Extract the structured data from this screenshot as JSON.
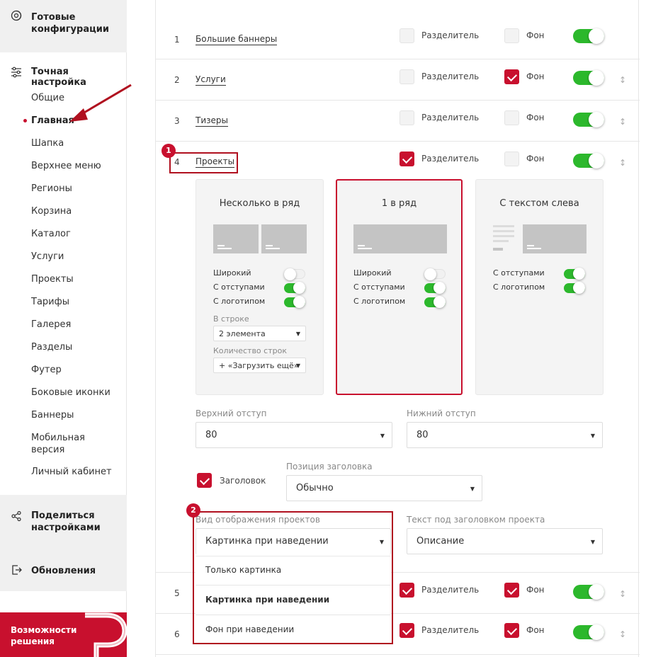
{
  "sidebar": {
    "ready_configs": "Готовые конфигурации",
    "fine_tuning": "Точная настройка",
    "items": [
      "Общие",
      "Главная",
      "Шапка",
      "Верхнее меню",
      "Регионы",
      "Корзина",
      "Каталог",
      "Услуги",
      "Проекты",
      "Тарифы",
      "Галерея",
      "Разделы",
      "Футер",
      "Боковые иконки",
      "Баннеры",
      "Мобильная версия",
      "Личный кабинет"
    ],
    "active_index": 1,
    "share": "Поделиться настройками",
    "updates": "Обновления",
    "promo": "Возможности решения"
  },
  "labels": {
    "separator": "Разделитель",
    "background": "Фон"
  },
  "rows": [
    {
      "num": "1",
      "name": "Большие баннеры",
      "separator": false,
      "background": false,
      "enabled": true
    },
    {
      "num": "2",
      "name": "Услуги",
      "separator": false,
      "background": true,
      "enabled": true
    },
    {
      "num": "3",
      "name": "Тизеры",
      "separator": false,
      "background": false,
      "enabled": true
    },
    {
      "num": "4",
      "name": "Проекты",
      "separator": true,
      "background": false,
      "enabled": true
    },
    {
      "num": "5",
      "name": "",
      "separator": true,
      "background": true,
      "enabled": true
    },
    {
      "num": "6",
      "name": "",
      "separator": true,
      "background": true,
      "enabled": true
    }
  ],
  "layouts": [
    {
      "title": "Несколько в ряд",
      "options": [
        {
          "label": "Широкий",
          "on": false
        },
        {
          "label": "С отступами",
          "on": true
        },
        {
          "label": "С логотипом",
          "on": true
        }
      ],
      "per_row_label": "В строке",
      "per_row_value": "2 элемента",
      "rows_label": "Количество строк",
      "rows_value": "+ «Загрузить ещё»"
    },
    {
      "title": "1 в ряд",
      "options": [
        {
          "label": "Широкий",
          "on": false
        },
        {
          "label": "С отступами",
          "on": true
        },
        {
          "label": "С логотипом",
          "on": true
        }
      ]
    },
    {
      "title": "С текстом слева",
      "options": [
        {
          "label": "С отступами",
          "on": true
        },
        {
          "label": "С логотипом",
          "on": true
        }
      ]
    }
  ],
  "settings": {
    "top_padding_label": "Верхний отступ",
    "top_padding_value": "80",
    "bottom_padding_label": "Нижний отступ",
    "bottom_padding_value": "80",
    "heading_label": "Заголовок",
    "heading_position_label": "Позиция заголовка",
    "heading_position_value": "Обычно",
    "view_label": "Вид отображения проектов",
    "view_value": "Картинка при наведении",
    "subtext_label": "Текст под заголовком проекта",
    "subtext_value": "Описание"
  },
  "dropdown": [
    "Только картинка",
    "Картинка при наведении",
    "Фон при наведении"
  ],
  "annotations": [
    "1",
    "2"
  ],
  "colors": {
    "accent": "#c8102e",
    "toggle_on": "#2cb82c"
  }
}
